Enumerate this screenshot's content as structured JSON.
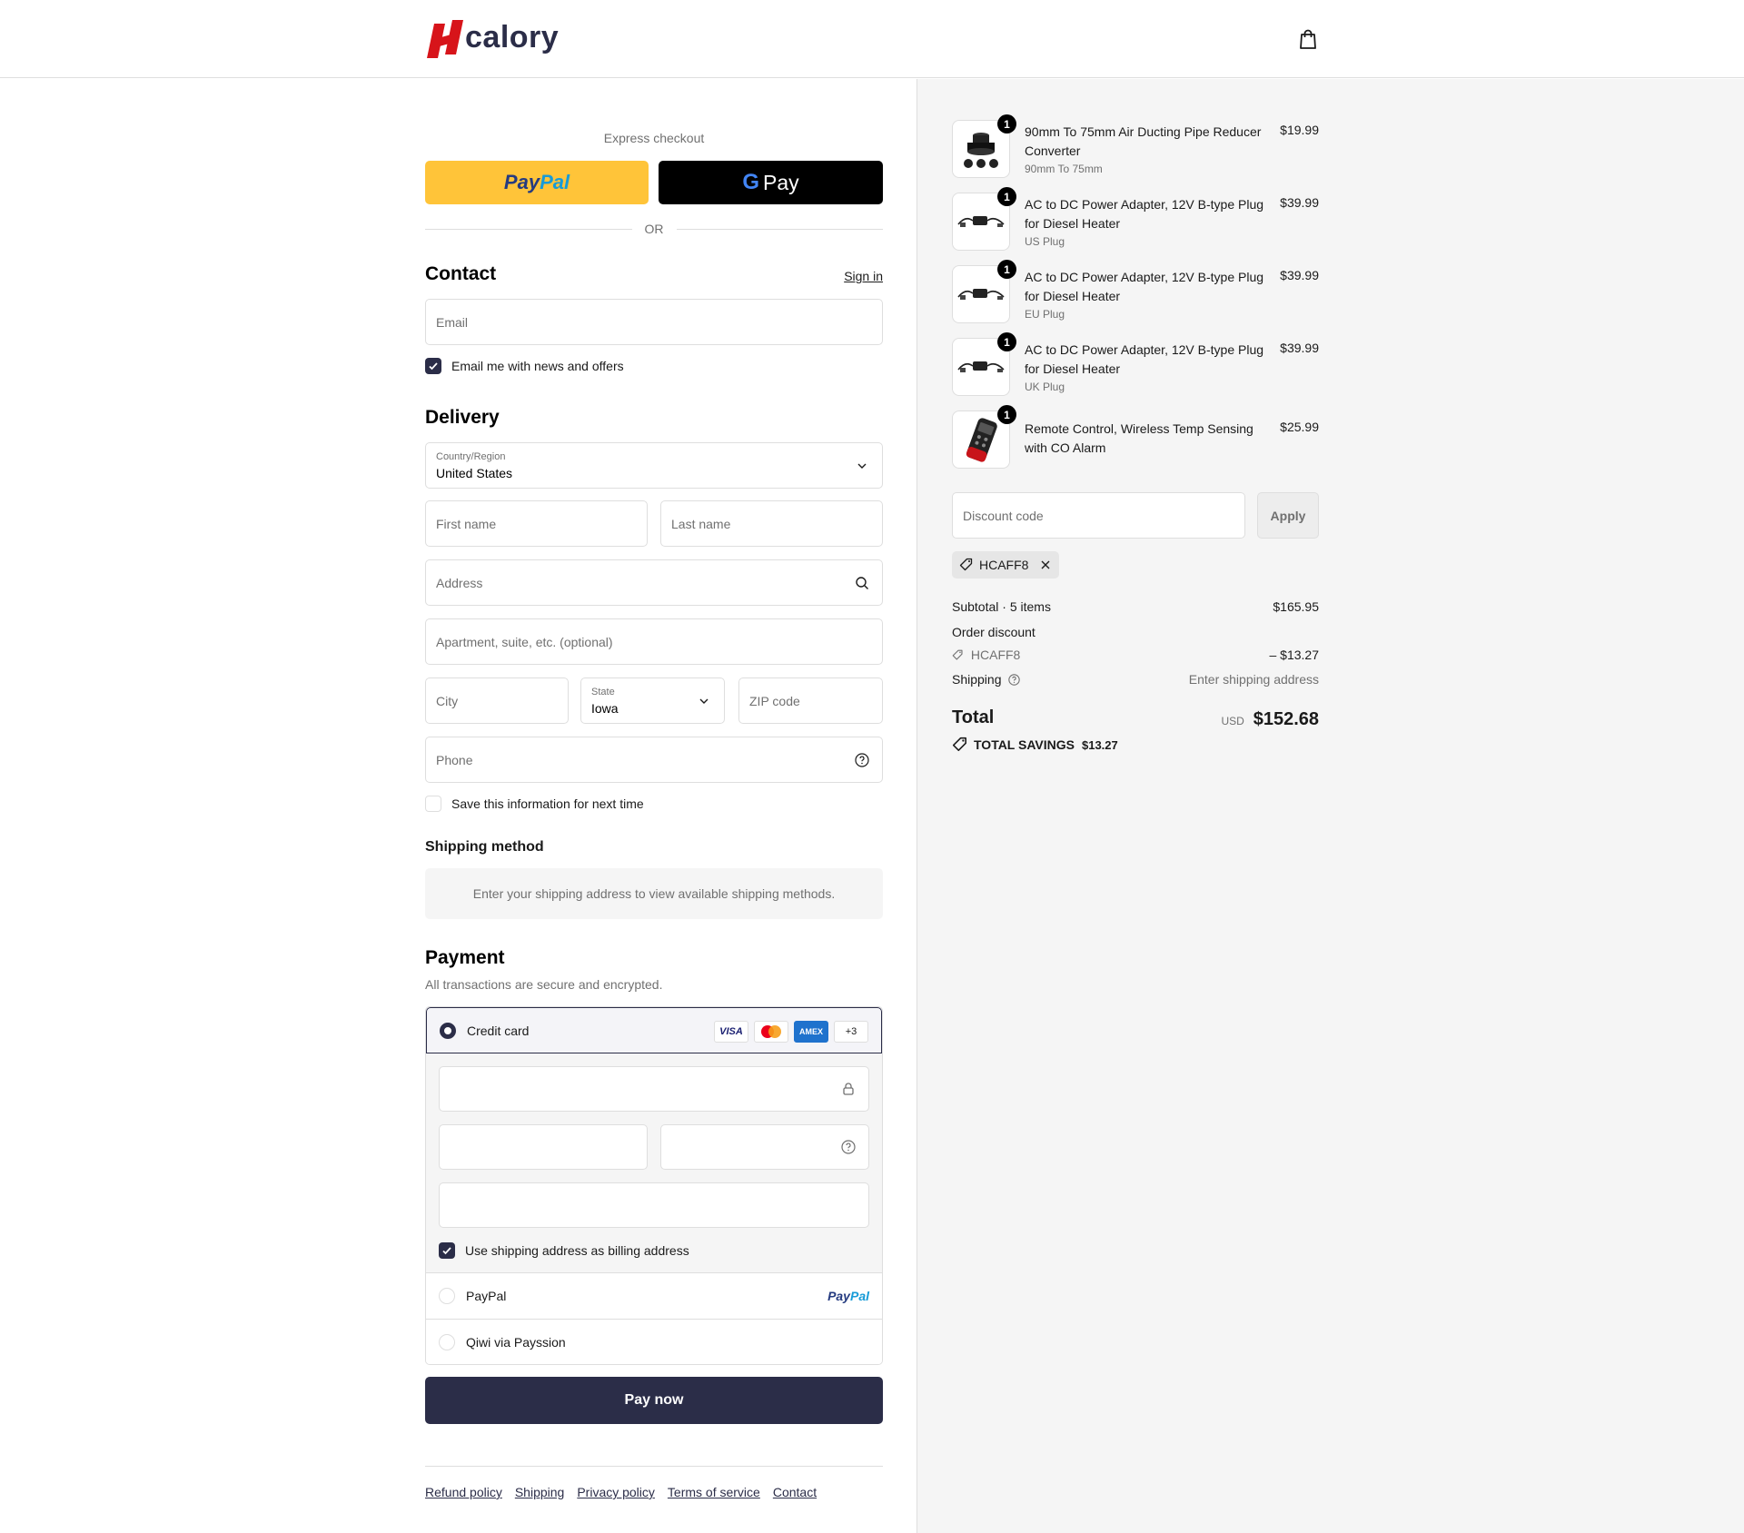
{
  "brand": {
    "name": "calory",
    "accent": "#d7141a",
    "primary": "#2b2d48"
  },
  "express": {
    "title": "Express checkout",
    "paypal_label": "PayPal",
    "gpay_label": "Pay",
    "or_label": "OR"
  },
  "contact": {
    "title": "Contact",
    "sign_in": "Sign in",
    "email_placeholder": "Email",
    "news_label": "Email me with news and offers",
    "news_checked": true
  },
  "delivery": {
    "title": "Delivery",
    "country_label": "Country/Region",
    "country_value": "United States",
    "first_name_placeholder": "First name",
    "last_name_placeholder": "Last name",
    "address_placeholder": "Address",
    "apartment_placeholder": "Apartment, suite, etc. (optional)",
    "city_placeholder": "City",
    "state_label": "State",
    "state_value": "Iowa",
    "zip_placeholder": "ZIP code",
    "phone_placeholder": "Phone",
    "save_label": "Save this information for next time",
    "save_checked": false
  },
  "shipping": {
    "title": "Shipping method",
    "message": "Enter your shipping address to view available shipping methods."
  },
  "payment": {
    "title": "Payment",
    "subtitle": "All transactions are secure and encrypted.",
    "credit_card_label": "Credit card",
    "card_badges": [
      "VISA",
      "mastercard",
      "AMEX",
      "+3"
    ],
    "billing_label": "Use shipping address as billing address",
    "billing_checked": true,
    "paypal_label": "PayPal",
    "paypal_logo": "PayPal",
    "qiwi_label": "Qiwi via Payssion",
    "pay_now": "Pay now"
  },
  "footer": {
    "links": [
      "Refund policy",
      "Shipping",
      "Privacy policy",
      "Terms of service",
      "Contact"
    ]
  },
  "summary": {
    "items": [
      {
        "qty": "1",
        "name": "90mm To 75mm Air Ducting Pipe Reducer Converter",
        "variant": "90mm To 75mm",
        "price": "$19.99",
        "icon": "pipe-reducer-image"
      },
      {
        "qty": "1",
        "name": "AC to DC Power Adapter, 12V B-type Plug for Diesel Heater",
        "variant": "US Plug",
        "price": "$39.99",
        "icon": "power-adapter-image"
      },
      {
        "qty": "1",
        "name": "AC to DC Power Adapter, 12V B-type Plug for Diesel Heater",
        "variant": "EU Plug",
        "price": "$39.99",
        "icon": "power-adapter-image"
      },
      {
        "qty": "1",
        "name": "AC to DC Power Adapter, 12V B-type Plug for Diesel Heater",
        "variant": "UK Plug",
        "price": "$39.99",
        "icon": "power-adapter-image"
      },
      {
        "qty": "1",
        "name": "Remote Control, Wireless Temp Sensing with CO Alarm",
        "variant": "",
        "price": "$25.99",
        "icon": "remote-control-image"
      }
    ],
    "discount_placeholder": "Discount code",
    "apply_label": "Apply",
    "applied_code": "HCAFF8",
    "subtotal_label": "Subtotal · 5 items",
    "subtotal_value": "$165.95",
    "order_discount_label": "Order discount",
    "discount_code": "HCAFF8",
    "discount_value": "– $13.27",
    "shipping_label": "Shipping",
    "shipping_value": "Enter shipping address",
    "total_label": "Total",
    "currency": "USD",
    "total_value": "$152.68",
    "savings_label": "TOTAL SAVINGS",
    "savings_value": "$13.27"
  }
}
